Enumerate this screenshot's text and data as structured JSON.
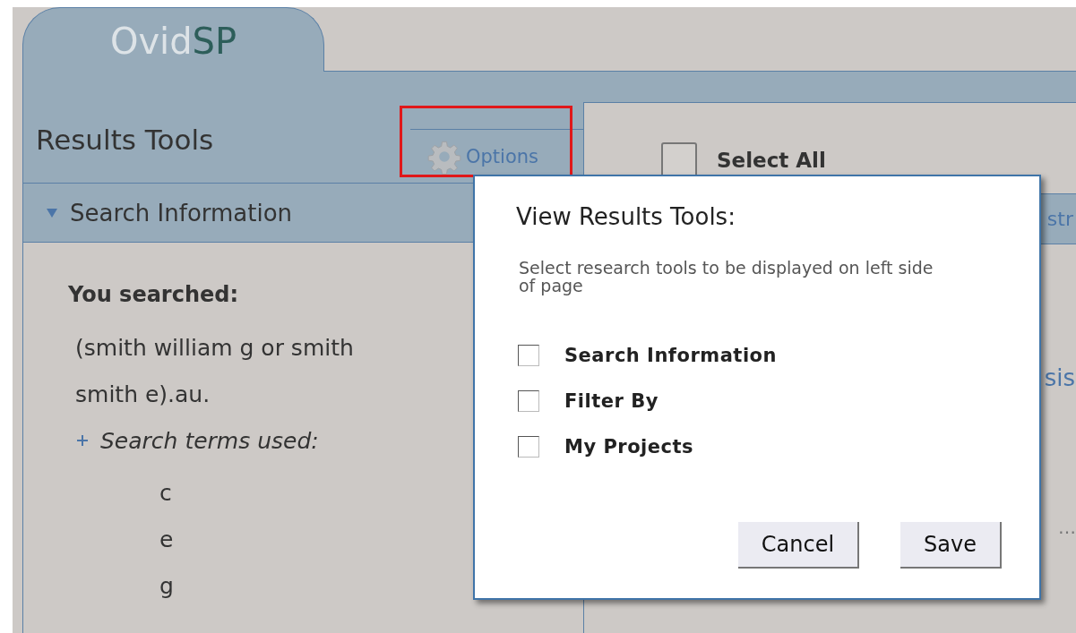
{
  "logo": {
    "part_1": "Ovid",
    "part_2": "SP"
  },
  "results_tools": {
    "title": "Results Tools",
    "options": {
      "label": "Options",
      "highlighted": true
    }
  },
  "search_information": {
    "label": "Search Information",
    "expanded": true,
    "heading": "You searched:",
    "query_lines": [
      "(smith william g or smith",
      "smith e).au."
    ],
    "terms": {
      "label": "Search terms used:",
      "expanded": false,
      "items": [
        "c",
        "e",
        "g"
      ]
    }
  },
  "results": {
    "select_all": {
      "label": "Select All",
      "checked": false
    },
    "toolbar_fragment": "str",
    "link_fragment": "sis",
    "ellipsis": "…"
  },
  "dialog": {
    "title": "View Results Tools:",
    "subtitle": "Select research tools to be displayed on left side of page",
    "options": [
      {
        "label": "Search Information",
        "checked": false
      },
      {
        "label": "Filter By",
        "checked": false
      },
      {
        "label": "My Projects",
        "checked": false
      }
    ],
    "buttons": [
      "Cancel",
      "Save"
    ]
  }
}
